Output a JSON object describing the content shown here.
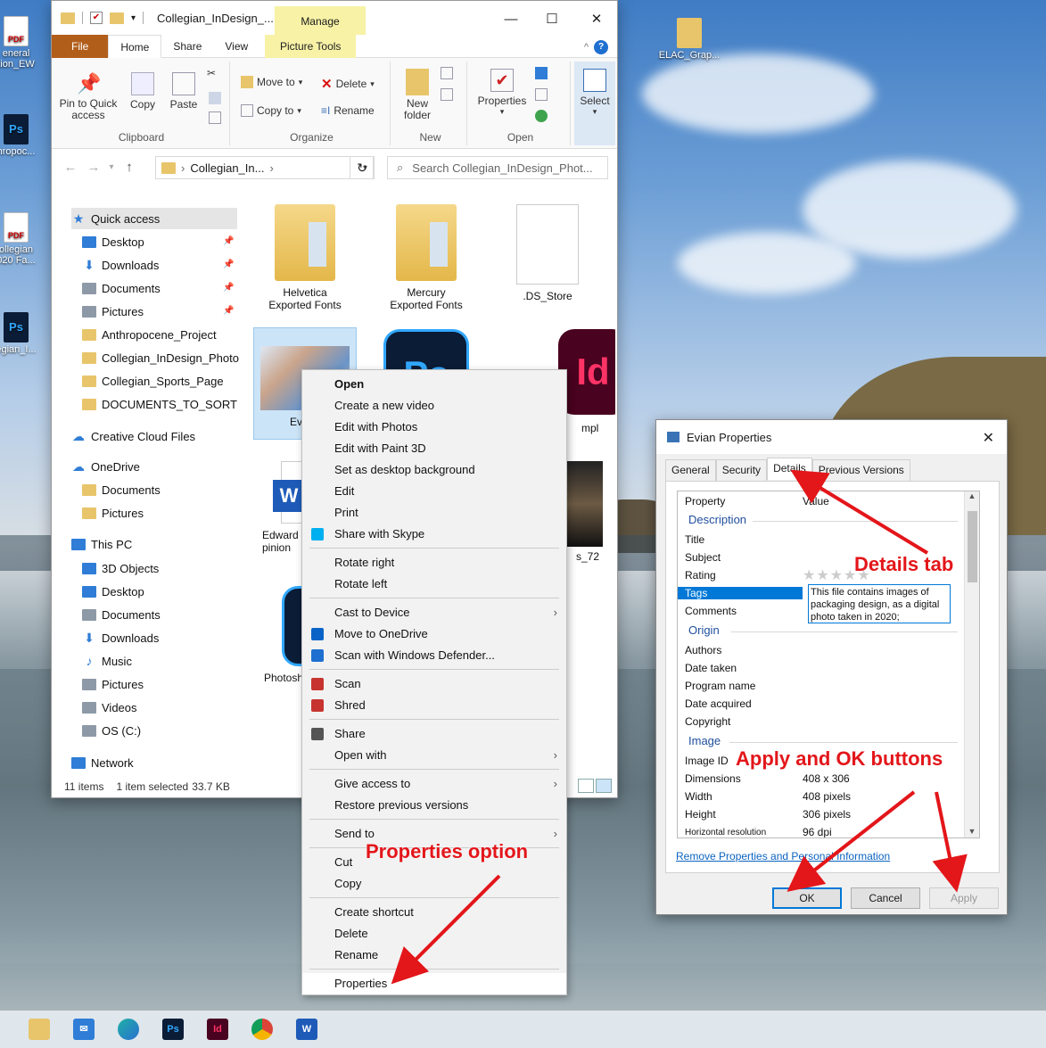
{
  "desktop": {
    "icons": [
      {
        "label": "eneral\ntion_EW",
        "kind": "pdf"
      },
      {
        "label": "hropoc...",
        "kind": "ps"
      },
      {
        "label": "ollegian\n020 Fa...",
        "kind": "pdf"
      },
      {
        "label": "egian_I...",
        "kind": "ps"
      },
      {
        "label": "ELAC_Grap...",
        "kind": "folder"
      }
    ],
    "pdf_text": "PDF"
  },
  "explorer": {
    "title": "Collegian_InDesign_...",
    "manage_label": "Manage",
    "window_controls": {
      "minimize": "—",
      "maximize": "☐",
      "close": "✕"
    },
    "tabs": [
      "File",
      "Home",
      "Share",
      "View",
      "Picture Tools"
    ],
    "ribbon": {
      "clipboard": {
        "label": "Clipboard",
        "pin": "Pin to Quick\naccess",
        "copy": "Copy",
        "paste": "Paste"
      },
      "organize": {
        "label": "Organize",
        "move_to": "Move to",
        "copy_to": "Copy to",
        "delete": "Delete",
        "rename": "Rename"
      },
      "new": {
        "label": "New",
        "new_folder": "New\nfolder"
      },
      "open": {
        "label": "Open",
        "properties": "Properties"
      },
      "select": {
        "label": "Select"
      }
    },
    "address": {
      "path": "Collegian_In...",
      "search_placeholder": "Search Collegian_InDesign_Phot..."
    },
    "nav": [
      {
        "label": "Quick access",
        "icon": "star",
        "selected": true,
        "pinned": false
      },
      {
        "label": "Desktop",
        "icon": "blue",
        "pinned": true
      },
      {
        "label": "Downloads",
        "icon": "download",
        "pinned": true
      },
      {
        "label": "Documents",
        "icon": "gray",
        "pinned": true
      },
      {
        "label": "Pictures",
        "icon": "gray",
        "pinned": true
      },
      {
        "label": "Anthropocene_Project",
        "icon": "folder",
        "pinned": false
      },
      {
        "label": "Collegian_InDesign_Photo",
        "icon": "folder",
        "pinned": false
      },
      {
        "label": "Collegian_Sports_Page",
        "icon": "folder",
        "pinned": false
      },
      {
        "label": "DOCUMENTS_TO_SORT",
        "icon": "folder",
        "pinned": false
      },
      {
        "label": "Creative Cloud Files",
        "icon": "cc",
        "pinned": false
      },
      {
        "label": "OneDrive",
        "icon": "cloud",
        "pinned": false
      },
      {
        "label": "Documents",
        "icon": "folder",
        "pinned": false
      },
      {
        "label": "Pictures",
        "icon": "folder",
        "pinned": false
      },
      {
        "label": "This PC",
        "icon": "pc",
        "pinned": false
      },
      {
        "label": "3D Objects",
        "icon": "blue",
        "pinned": false
      },
      {
        "label": "Desktop",
        "icon": "blue",
        "pinned": false
      },
      {
        "label": "Documents",
        "icon": "gray",
        "pinned": false
      },
      {
        "label": "Downloads",
        "icon": "download",
        "pinned": false
      },
      {
        "label": "Music",
        "icon": "music",
        "pinned": false
      },
      {
        "label": "Pictures",
        "icon": "gray",
        "pinned": false
      },
      {
        "label": "Videos",
        "icon": "gray",
        "pinned": false
      },
      {
        "label": "OS (C:)",
        "icon": "gray",
        "pinned": false
      },
      {
        "label": "Network",
        "icon": "blue",
        "pinned": false
      }
    ],
    "files": [
      {
        "label": "Helvetica\nExported Fonts",
        "kind": "folder"
      },
      {
        "label": "Mercury\nExported Fonts",
        "kind": "folder"
      },
      {
        "label": ".DS_Store",
        "kind": "blank"
      },
      {
        "label": "Ev",
        "kind": "photo"
      },
      {
        "label": "",
        "kind": "ps"
      },
      {
        "label": "mpl",
        "kind": "id"
      },
      {
        "label": "Edward\npinion",
        "kind": "word"
      },
      {
        "label": "s_72",
        "kind": "photo2"
      },
      {
        "label": "Photosh",
        "kind": "ps2"
      }
    ],
    "status": {
      "items": "11 items",
      "selected": "1 item selected",
      "size": "33.7 KB"
    }
  },
  "context_menu": {
    "items": [
      {
        "label": "Open",
        "bold": true
      },
      {
        "label": "Create a new video"
      },
      {
        "label": "Edit with Photos"
      },
      {
        "label": "Edit with Paint 3D"
      },
      {
        "label": "Set as desktop background"
      },
      {
        "label": "Edit"
      },
      {
        "label": "Print"
      },
      {
        "label": "Share with Skype",
        "icon": "skype"
      },
      {
        "sep": true
      },
      {
        "label": "Rotate right"
      },
      {
        "label": "Rotate left"
      },
      {
        "sep": true
      },
      {
        "label": "Cast to Device",
        "sub": true
      },
      {
        "label": "Move to OneDrive",
        "icon": "cloud"
      },
      {
        "label": "Scan with Windows Defender...",
        "icon": "defender"
      },
      {
        "sep": true
      },
      {
        "label": "Scan",
        "icon": "scan"
      },
      {
        "label": "Shred",
        "icon": "scan"
      },
      {
        "sep": true
      },
      {
        "label": "Share",
        "icon": "share"
      },
      {
        "label": "Open with",
        "sub": true
      },
      {
        "sep": true
      },
      {
        "label": "Give access to",
        "sub": true
      },
      {
        "label": "Restore previous versions"
      },
      {
        "sep": true
      },
      {
        "label": "Send to",
        "sub": true
      },
      {
        "sep": true
      },
      {
        "label": "Cut"
      },
      {
        "label": "Copy"
      },
      {
        "sep": true
      },
      {
        "label": "Create shortcut"
      },
      {
        "label": "Delete"
      },
      {
        "label": "Rename"
      },
      {
        "sep": true
      },
      {
        "label": "Properties",
        "highlight": true
      }
    ]
  },
  "properties_dialog": {
    "title": "Evian Properties",
    "tabs": [
      "General",
      "Security",
      "Details",
      "Previous Versions"
    ],
    "active_tab": "Details",
    "columns": {
      "property": "Property",
      "value": "Value"
    },
    "sections": {
      "description": "Description",
      "origin": "Origin",
      "image": "Image"
    },
    "rows": {
      "title": "Title",
      "subject": "Subject",
      "rating": "Rating",
      "tags": "Tags",
      "tags_value": "This file contains images of packaging design, as a digital photo taken in 2020;",
      "comments": "Comments",
      "authors": "Authors",
      "date_taken": "Date taken",
      "program_name": "Program name",
      "date_acquired": "Date acquired",
      "copyright": "Copyright",
      "image_id": "Image ID",
      "dimensions": "Dimensions",
      "dimensions_value": "408 x 306",
      "width": "Width",
      "width_value": "408 pixels",
      "height": "Height",
      "height_value": "306 pixels",
      "hres": "Horizontal resolution",
      "hres_value": "96 dpi"
    },
    "rating_stars": "★★★★★",
    "remove_link": "Remove Properties and Personal Information",
    "buttons": {
      "ok": "OK",
      "cancel": "Cancel",
      "apply": "Apply"
    }
  },
  "annotations": {
    "details_tab": "Details tab",
    "apply_ok": "Apply and OK buttons",
    "properties_option": "Properties option",
    "color": "#e3161a"
  }
}
